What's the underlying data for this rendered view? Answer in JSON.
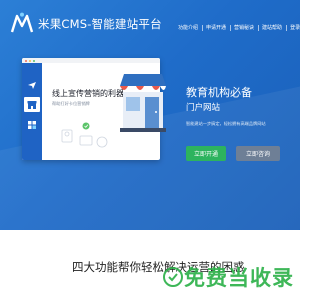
{
  "header": {
    "title": "米果CMS-智能建站平台",
    "nav": [
      "功能介绍",
      "申请开通",
      "营销秘诀",
      "建站帮助",
      "登录"
    ]
  },
  "panel": {
    "headline": "线上宣传营销的利器",
    "subtext": "帮助打好卡位营销牌",
    "rail_icons": [
      "plane-icon",
      "store-icon",
      "grid-icon"
    ]
  },
  "hero": {
    "title": "教育机构必备",
    "subtitle": "门户网站",
    "description": "智能建站一步搞定，轻松拥有高端品牌网站",
    "primary_button": "立即开通",
    "secondary_button": "立即咨询"
  },
  "section": {
    "title": "四大功能帮你轻松解决运营的困惑"
  },
  "watermark": "免费当收录",
  "colors": {
    "hero_blue": "#2c7fd6",
    "rail_blue": "#1f63c4",
    "button_green": "#2db35e",
    "button_gray": "#6e7f96",
    "watermark_green": "#2eb14a"
  }
}
